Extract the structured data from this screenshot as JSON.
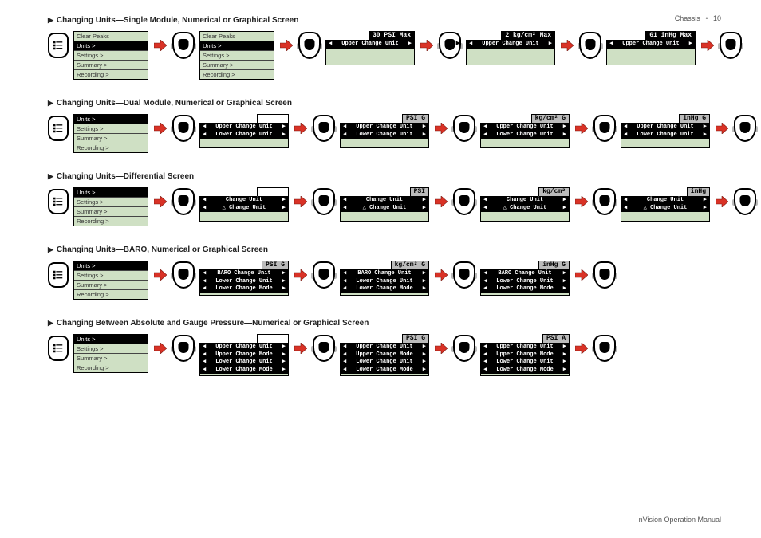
{
  "page_header": {
    "section": "Chassis",
    "page_num": "10"
  },
  "page_footer": "nVision Operation Manual",
  "sections": [
    {
      "title": "Changing Units—Single Module, Numerical or Graphical Screen",
      "flow": [
        {
          "type": "device"
        },
        {
          "type": "menu",
          "rows": [
            {
              "t": "Clear Peaks"
            },
            {
              "t": "Units >",
              "sel": true
            },
            {
              "t": "Settings >"
            },
            {
              "t": "Summary >"
            },
            {
              "t": "Recording >"
            }
          ]
        },
        {
          "type": "arrow"
        },
        {
          "type": "btn",
          "mark": null
        },
        {
          "type": "menu",
          "rows": [
            {
              "t": "Clear Peaks"
            },
            {
              "t": "Units >",
              "sel": true
            },
            {
              "t": "Settings >"
            },
            {
              "t": "Summary >"
            },
            {
              "t": "Recording >"
            }
          ]
        },
        {
          "type": "arrow"
        },
        {
          "type": "btn",
          "mark": null
        },
        {
          "type": "screen",
          "head": "30 PSI Max",
          "head_style": "black",
          "bars": [
            {
              "t": "Upper Change Unit"
            }
          ],
          "pad": 2
        },
        {
          "type": "arrow"
        },
        {
          "type": "btn",
          "mark": "r"
        },
        {
          "type": "screen",
          "head": "2 kg/cm² Max",
          "head_style": "black",
          "bars": [
            {
              "t": "Upper Change Unit"
            }
          ],
          "pad": 2
        },
        {
          "type": "arrow"
        },
        {
          "type": "btn",
          "mark": null
        },
        {
          "type": "screen",
          "head": "61 inHg Max",
          "head_style": "black",
          "bars": [
            {
              "t": "Upper Change Unit"
            }
          ],
          "pad": 2
        },
        {
          "type": "arrow"
        },
        {
          "type": "btn",
          "mark": null
        }
      ]
    },
    {
      "title": "Changing Units—Dual Module, Numerical or Graphical Screen",
      "flow": [
        {
          "type": "device"
        },
        {
          "type": "menu",
          "rows": [
            {
              "t": "Units >",
              "sel": true
            },
            {
              "t": "Settings >"
            },
            {
              "t": "Summary >"
            },
            {
              "t": "Recording >"
            }
          ]
        },
        {
          "type": "arrow"
        },
        {
          "type": "btn",
          "mark": null
        },
        {
          "type": "screen",
          "head": "",
          "head_style": "blank",
          "bars": [
            {
              "t": "Upper Change Unit"
            },
            {
              "t": "Lower Change Unit"
            }
          ],
          "pad": 1
        },
        {
          "type": "arrow"
        },
        {
          "type": "btn",
          "mark": null
        },
        {
          "type": "screen",
          "head": "PSI G",
          "head_style": "gray",
          "bars": [
            {
              "t": "Upper Change Unit"
            },
            {
              "t": "Lower Change Unit"
            }
          ],
          "pad": 1
        },
        {
          "type": "arrow"
        },
        {
          "type": "btn",
          "mark": null
        },
        {
          "type": "screen",
          "head": "kg/cm² G",
          "head_style": "gray",
          "bars": [
            {
              "t": "Upper Change Unit"
            },
            {
              "t": "Lower Change Unit"
            }
          ],
          "pad": 1
        },
        {
          "type": "arrow"
        },
        {
          "type": "btn",
          "mark": null
        },
        {
          "type": "screen",
          "head": "inHg G",
          "head_style": "gray",
          "bars": [
            {
              "t": "Upper Change Unit"
            },
            {
              "t": "Lower Change Unit"
            }
          ],
          "pad": 1
        },
        {
          "type": "arrow"
        },
        {
          "type": "btn",
          "mark": null
        }
      ]
    },
    {
      "title": "Changing Units—Differential Screen",
      "flow": [
        {
          "type": "device"
        },
        {
          "type": "menu",
          "rows": [
            {
              "t": "Units >",
              "sel": true
            },
            {
              "t": "Settings >"
            },
            {
              "t": "Summary >"
            },
            {
              "t": "Recording >"
            }
          ]
        },
        {
          "type": "arrow"
        },
        {
          "type": "btn",
          "mark": null
        },
        {
          "type": "screen",
          "head": "",
          "head_style": "blank",
          "bars": [
            {
              "t": "Change Unit"
            },
            {
              "t": "Change Unit",
              "delta": true
            }
          ],
          "pad": 1
        },
        {
          "type": "arrow"
        },
        {
          "type": "btn",
          "mark": null
        },
        {
          "type": "screen",
          "head": "PSI",
          "head_style": "gray",
          "bars": [
            {
              "t": "Change Unit"
            },
            {
              "t": "Change Unit",
              "delta": true
            }
          ],
          "pad": 1
        },
        {
          "type": "arrow"
        },
        {
          "type": "btn",
          "mark": null
        },
        {
          "type": "screen",
          "head": "kg/cm²",
          "head_style": "gray",
          "bars": [
            {
              "t": "Change Unit"
            },
            {
              "t": "Change Unit",
              "delta": true
            }
          ],
          "pad": 1
        },
        {
          "type": "arrow"
        },
        {
          "type": "btn",
          "mark": null
        },
        {
          "type": "screen",
          "head": "inHg",
          "head_style": "gray",
          "bars": [
            {
              "t": "Change Unit"
            },
            {
              "t": "Change Unit",
              "delta": true
            }
          ],
          "pad": 1
        },
        {
          "type": "arrow"
        },
        {
          "type": "btn",
          "mark": null
        }
      ]
    },
    {
      "title": "Changing Units—BARO, Numerical or Graphical Screen",
      "flow": [
        {
          "type": "device"
        },
        {
          "type": "menu",
          "rows": [
            {
              "t": "Units >",
              "sel": true
            },
            {
              "t": "Settings >"
            },
            {
              "t": "Summary >"
            },
            {
              "t": "Recording >"
            }
          ]
        },
        {
          "type": "arrow"
        },
        {
          "type": "btn",
          "mark": null
        },
        {
          "type": "screen",
          "head": "PSI G",
          "head_style": "gray",
          "bars": [
            {
              "t": "BARO Change Unit"
            },
            {
              "t": "Lower Change Unit"
            },
            {
              "t": "Lower Change Mode"
            }
          ]
        },
        {
          "type": "arrow"
        },
        {
          "type": "btn",
          "mark": null
        },
        {
          "type": "screen",
          "head": "kg/cm² G",
          "head_style": "gray",
          "bars": [
            {
              "t": "BARO Change Unit"
            },
            {
              "t": "Lower Change Unit"
            },
            {
              "t": "Lower Change Mode"
            }
          ]
        },
        {
          "type": "arrow"
        },
        {
          "type": "btn",
          "mark": null
        },
        {
          "type": "screen",
          "head": "inHg G",
          "head_style": "gray",
          "bars": [
            {
              "t": "BARO Change Unit"
            },
            {
              "t": "Lower Change Unit"
            },
            {
              "t": "Lower Change Mode"
            }
          ]
        },
        {
          "type": "arrow"
        },
        {
          "type": "btn",
          "mark": null
        }
      ]
    },
    {
      "title": "Changing Between Absolute and Gauge Pressure—Numerical or Graphical Screen",
      "flow": [
        {
          "type": "device"
        },
        {
          "type": "menu",
          "rows": [
            {
              "t": "Units >",
              "sel": true
            },
            {
              "t": "Settings >"
            },
            {
              "t": "Summary >"
            },
            {
              "t": "Recording >"
            }
          ]
        },
        {
          "type": "arrow"
        },
        {
          "type": "btn",
          "mark": null
        },
        {
          "type": "screen",
          "head": "",
          "head_style": "blank",
          "bars": [
            {
              "t": "Upper Change Unit"
            },
            {
              "t": "Upper Change Mode"
            },
            {
              "t": "Lower Change Unit"
            },
            {
              "t": "Lower Change Mode"
            }
          ]
        },
        {
          "type": "arrow"
        },
        {
          "type": "btn",
          "mark": null
        },
        {
          "type": "screen",
          "head": "PSI G",
          "head_style": "gray",
          "bars": [
            {
              "t": "Upper Change Unit"
            },
            {
              "t": "Upper Change Mode"
            },
            {
              "t": "Lower Change Unit"
            },
            {
              "t": "Lower Change Mode"
            }
          ]
        },
        {
          "type": "arrow"
        },
        {
          "type": "btn",
          "mark": null
        },
        {
          "type": "screen",
          "head": "PSI A",
          "head_style": "gray",
          "bars": [
            {
              "t": "Upper Change Unit"
            },
            {
              "t": "Upper Change Mode"
            },
            {
              "t": "Lower Change Unit"
            },
            {
              "t": "Lower Change Mode"
            }
          ]
        },
        {
          "type": "arrow"
        },
        {
          "type": "btn",
          "mark": null
        }
      ]
    }
  ]
}
